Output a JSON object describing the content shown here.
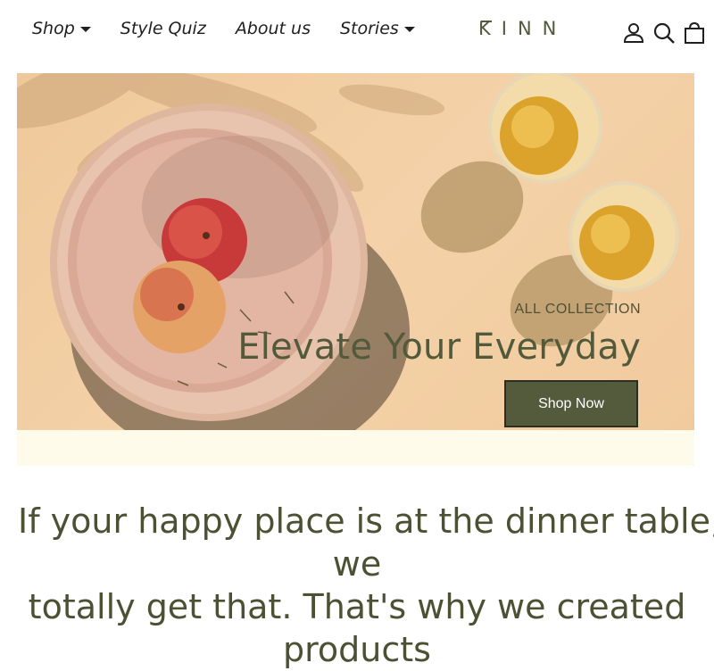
{
  "nav": {
    "items": [
      {
        "label": "Shop",
        "has_dropdown": true
      },
      {
        "label": "Style Quiz",
        "has_dropdown": false
      },
      {
        "label": "About us",
        "has_dropdown": false
      },
      {
        "label": "Stories",
        "has_dropdown": true
      }
    ]
  },
  "brand": {
    "logo": "KINN",
    "color": "#525a3b"
  },
  "header_icons": [
    "account-icon",
    "search-icon",
    "cart-icon"
  ],
  "hero": {
    "subtitle": "ALL COLLECTION",
    "title": "Elevate Your Everyday",
    "button_label": "Shop Now",
    "button_color": "#545a3c"
  },
  "intro": {
    "lines": [
      "If your happy place is at the dinner table,",
      "we",
      "totally get that. That's why we created",
      "products"
    ]
  }
}
